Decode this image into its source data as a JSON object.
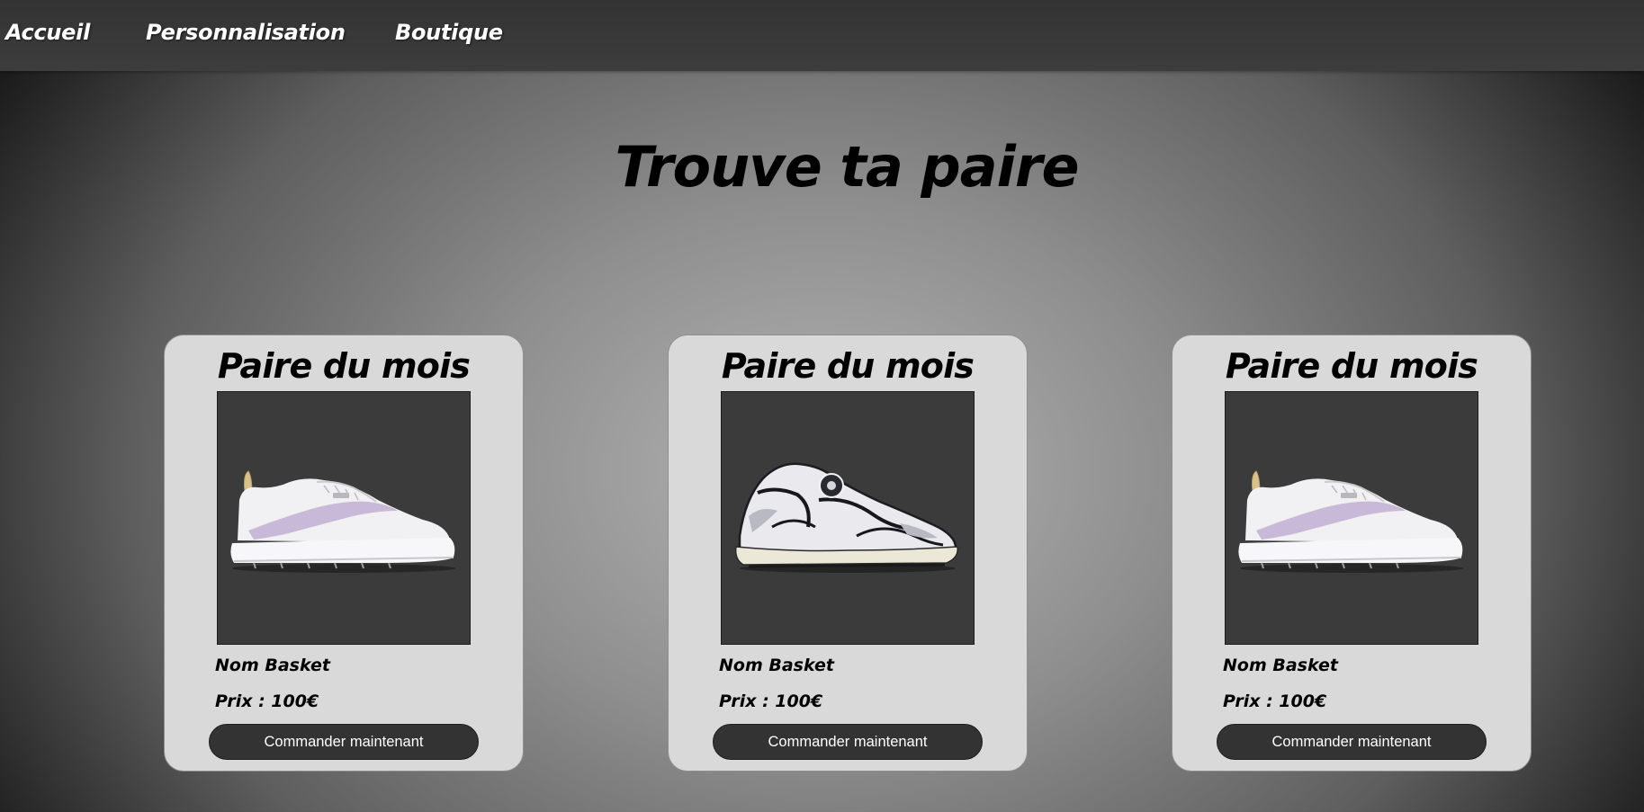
{
  "nav": {
    "items": [
      {
        "label": "Accueil"
      },
      {
        "label": "Personnalisation"
      },
      {
        "label": "Boutique"
      }
    ]
  },
  "hero": {
    "title": "Trouve ta paire"
  },
  "cards": [
    {
      "title": "Paire du mois",
      "product_image": "sneaker-white-lilac-platform",
      "name": "Nom Basket",
      "price": "Prix : 100€",
      "button_label": "Commander maintenant"
    },
    {
      "title": "Paire du mois",
      "product_image": "sneaker-white-black-chunky-runner",
      "name": "Nom Basket",
      "price": "Prix : 100€",
      "button_label": "Commander maintenant"
    },
    {
      "title": "Paire du mois",
      "product_image": "sneaker-white-lilac-platform",
      "name": "Nom Basket",
      "price": "Prix : 100€",
      "button_label": "Commander maintenant"
    }
  ],
  "colors": {
    "nav_bg": "#3a3a3a",
    "card_bg": "#d9d9d9",
    "photo_bg": "#3b3b3b",
    "button_bg": "#333333",
    "text_dark": "#000000",
    "text_light": "#ffffff"
  }
}
